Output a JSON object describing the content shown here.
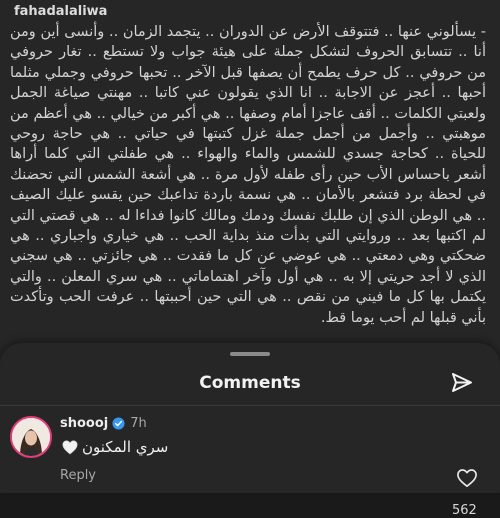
{
  "post": {
    "username": "fahadalaliwa",
    "caption": "- يسألوني عنها .. فتتوقف الأرض عن الدوران .. يتجمد الزمان .. وأنسى أين ومن أنا .. تتسابق الحروف لتشكل جملة على هيئة جواب ولا تستطع .. تغار حروفي من حروفي .. كل حرف يطمح أن يصفها قبل الآخر .. تحبها حروفي وجملي مثلما أحبها .. أعجز عن الاجابة .. انا الذي يقولون عني كاتبا .. مهنتي صياغة الجمل ولعبتي الكلمات .. أقف عاجزا أمام وصفها .. هي أكبر من خيالي .. هي أعظم من موهبتي .. وأجمل من أجمل جملة غزل كتبتها في حياتي .. هي حاجة روحي للحياة .. كحاجة جسدي للشمس والماء والهواء .. هي طفلتي التي كلما أراها أشعر باحساس الأب حين رأى طفله لأول مرة .. هي أشعة الشمس التي تحضنك في لحظة برد فتشعر بالأمان .. هي نسمة باردة تداعبك حين يقسو عليك الصيف .. هي الوطن الذي إن طلبك نفسك ودمك ومالك كانوا فداءا له .. هي قصتي التي لم اكتبها بعد .. وروايتي التي بدأت منذ بداية الحب .. هي خياري واجباري .. هي ضحكتي وهي دمعتي .. هي عوضي عن كل ما فقدت .. هي جائزتي .. هي سجني الذي لا أجد حريتي إلا به .. هي أول وآخر اهتماماتي .. هي سري المعلن .. والتي يكتمل بها كل ما فيني من نقص .. هي التي حين أحببتها .. عرفت الحب وتأكدت بأني قبلها لم أحب يوما قط."
  },
  "comments_sheet": {
    "title": "Comments",
    "share_icon": "paper-plane-icon"
  },
  "comment": {
    "username": "shoooj",
    "verified": true,
    "time": "7h",
    "text": "سري المكنون",
    "emoji": "white-heart",
    "reply_label": "Reply",
    "like_count": "562"
  },
  "colors": {
    "background": "#262626",
    "verified": "#3897f0",
    "avatar_ring": "#e43b7a"
  }
}
